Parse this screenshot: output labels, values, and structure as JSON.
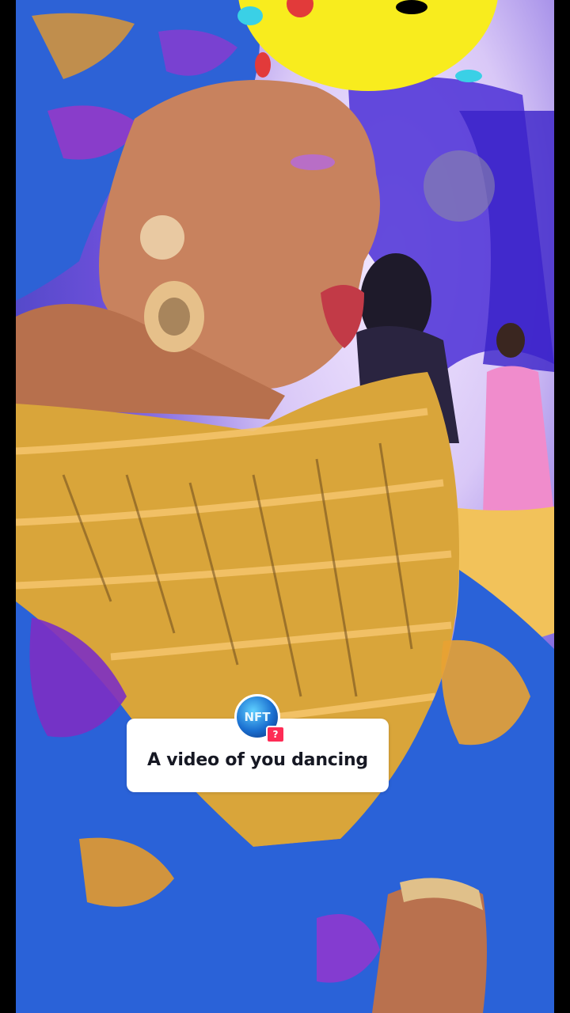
{
  "prompt": {
    "text": "A video of you dancing",
    "avatar_label": "NFT",
    "badge_symbol": "?"
  },
  "colors": {
    "card_background": "#ffffff",
    "text": "#161823",
    "badge": "#fe2c55",
    "sticker": "#f8ec1e"
  },
  "icons": [
    "nft-avatar-icon",
    "question-badge-icon"
  ]
}
